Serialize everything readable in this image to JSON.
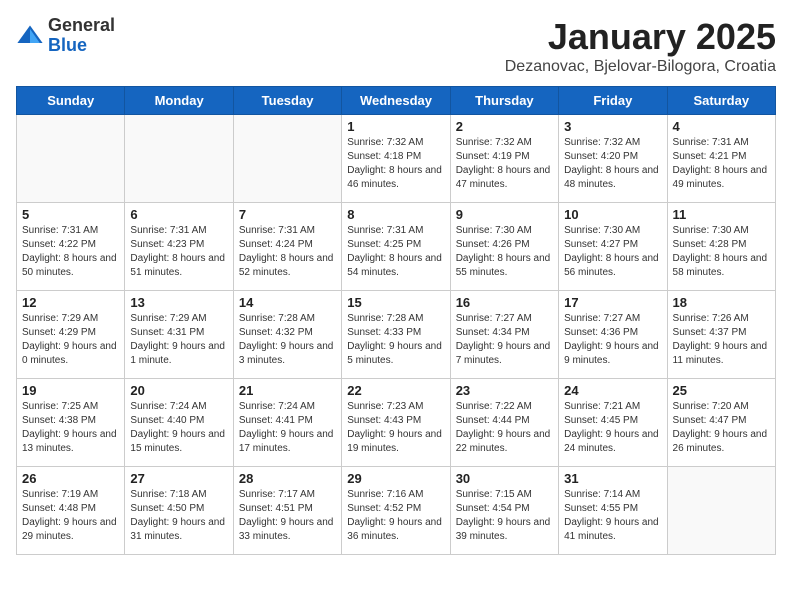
{
  "header": {
    "logo": {
      "general": "General",
      "blue": "Blue"
    },
    "title": "January 2025",
    "subtitle": "Dezanovac, Bjelovar-Bilogora, Croatia"
  },
  "calendar": {
    "weekdays": [
      "Sunday",
      "Monday",
      "Tuesday",
      "Wednesday",
      "Thursday",
      "Friday",
      "Saturday"
    ],
    "weeks": [
      [
        {
          "day": "",
          "info": ""
        },
        {
          "day": "",
          "info": ""
        },
        {
          "day": "",
          "info": ""
        },
        {
          "day": "1",
          "info": "Sunrise: 7:32 AM\nSunset: 4:18 PM\nDaylight: 8 hours and 46 minutes."
        },
        {
          "day": "2",
          "info": "Sunrise: 7:32 AM\nSunset: 4:19 PM\nDaylight: 8 hours and 47 minutes."
        },
        {
          "day": "3",
          "info": "Sunrise: 7:32 AM\nSunset: 4:20 PM\nDaylight: 8 hours and 48 minutes."
        },
        {
          "day": "4",
          "info": "Sunrise: 7:31 AM\nSunset: 4:21 PM\nDaylight: 8 hours and 49 minutes."
        }
      ],
      [
        {
          "day": "5",
          "info": "Sunrise: 7:31 AM\nSunset: 4:22 PM\nDaylight: 8 hours and 50 minutes."
        },
        {
          "day": "6",
          "info": "Sunrise: 7:31 AM\nSunset: 4:23 PM\nDaylight: 8 hours and 51 minutes."
        },
        {
          "day": "7",
          "info": "Sunrise: 7:31 AM\nSunset: 4:24 PM\nDaylight: 8 hours and 52 minutes."
        },
        {
          "day": "8",
          "info": "Sunrise: 7:31 AM\nSunset: 4:25 PM\nDaylight: 8 hours and 54 minutes."
        },
        {
          "day": "9",
          "info": "Sunrise: 7:30 AM\nSunset: 4:26 PM\nDaylight: 8 hours and 55 minutes."
        },
        {
          "day": "10",
          "info": "Sunrise: 7:30 AM\nSunset: 4:27 PM\nDaylight: 8 hours and 56 minutes."
        },
        {
          "day": "11",
          "info": "Sunrise: 7:30 AM\nSunset: 4:28 PM\nDaylight: 8 hours and 58 minutes."
        }
      ],
      [
        {
          "day": "12",
          "info": "Sunrise: 7:29 AM\nSunset: 4:29 PM\nDaylight: 9 hours and 0 minutes."
        },
        {
          "day": "13",
          "info": "Sunrise: 7:29 AM\nSunset: 4:31 PM\nDaylight: 9 hours and 1 minute."
        },
        {
          "day": "14",
          "info": "Sunrise: 7:28 AM\nSunset: 4:32 PM\nDaylight: 9 hours and 3 minutes."
        },
        {
          "day": "15",
          "info": "Sunrise: 7:28 AM\nSunset: 4:33 PM\nDaylight: 9 hours and 5 minutes."
        },
        {
          "day": "16",
          "info": "Sunrise: 7:27 AM\nSunset: 4:34 PM\nDaylight: 9 hours and 7 minutes."
        },
        {
          "day": "17",
          "info": "Sunrise: 7:27 AM\nSunset: 4:36 PM\nDaylight: 9 hours and 9 minutes."
        },
        {
          "day": "18",
          "info": "Sunrise: 7:26 AM\nSunset: 4:37 PM\nDaylight: 9 hours and 11 minutes."
        }
      ],
      [
        {
          "day": "19",
          "info": "Sunrise: 7:25 AM\nSunset: 4:38 PM\nDaylight: 9 hours and 13 minutes."
        },
        {
          "day": "20",
          "info": "Sunrise: 7:24 AM\nSunset: 4:40 PM\nDaylight: 9 hours and 15 minutes."
        },
        {
          "day": "21",
          "info": "Sunrise: 7:24 AM\nSunset: 4:41 PM\nDaylight: 9 hours and 17 minutes."
        },
        {
          "day": "22",
          "info": "Sunrise: 7:23 AM\nSunset: 4:43 PM\nDaylight: 9 hours and 19 minutes."
        },
        {
          "day": "23",
          "info": "Sunrise: 7:22 AM\nSunset: 4:44 PM\nDaylight: 9 hours and 22 minutes."
        },
        {
          "day": "24",
          "info": "Sunrise: 7:21 AM\nSunset: 4:45 PM\nDaylight: 9 hours and 24 minutes."
        },
        {
          "day": "25",
          "info": "Sunrise: 7:20 AM\nSunset: 4:47 PM\nDaylight: 9 hours and 26 minutes."
        }
      ],
      [
        {
          "day": "26",
          "info": "Sunrise: 7:19 AM\nSunset: 4:48 PM\nDaylight: 9 hours and 29 minutes."
        },
        {
          "day": "27",
          "info": "Sunrise: 7:18 AM\nSunset: 4:50 PM\nDaylight: 9 hours and 31 minutes."
        },
        {
          "day": "28",
          "info": "Sunrise: 7:17 AM\nSunset: 4:51 PM\nDaylight: 9 hours and 33 minutes."
        },
        {
          "day": "29",
          "info": "Sunrise: 7:16 AM\nSunset: 4:52 PM\nDaylight: 9 hours and 36 minutes."
        },
        {
          "day": "30",
          "info": "Sunrise: 7:15 AM\nSunset: 4:54 PM\nDaylight: 9 hours and 39 minutes."
        },
        {
          "day": "31",
          "info": "Sunrise: 7:14 AM\nSunset: 4:55 PM\nDaylight: 9 hours and 41 minutes."
        },
        {
          "day": "",
          "info": ""
        }
      ]
    ]
  }
}
